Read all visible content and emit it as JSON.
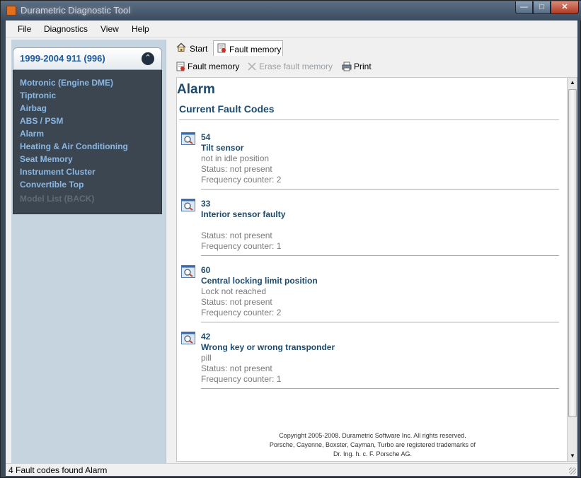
{
  "window": {
    "title": "Durametric Diagnostic Tool"
  },
  "menu": [
    "File",
    "Diagnostics",
    "View",
    "Help"
  ],
  "sidebar": {
    "model": "1999-2004 911 (996)",
    "modules": [
      {
        "label": "Motronic (Engine DME)",
        "enabled": true
      },
      {
        "label": "Tiptronic",
        "enabled": true
      },
      {
        "label": "Airbag",
        "enabled": true
      },
      {
        "label": "ABS / PSM",
        "enabled": true
      },
      {
        "label": "Alarm",
        "enabled": true
      },
      {
        "label": "Heating & Air Conditioning",
        "enabled": true
      },
      {
        "label": "Seat Memory",
        "enabled": true
      },
      {
        "label": "Instrument Cluster",
        "enabled": true
      },
      {
        "label": "Convertible Top",
        "enabled": true
      },
      {
        "label": "Model List (BACK)",
        "enabled": false
      }
    ]
  },
  "tabs": [
    {
      "label": "Start",
      "icon": "home-icon"
    },
    {
      "label": "Fault memory",
      "icon": "fault-memory-icon",
      "active": true
    }
  ],
  "toolbar": {
    "fault_memory": "Fault memory",
    "erase": "Erase fault memory",
    "print": "Print"
  },
  "content": {
    "title": "Alarm",
    "section": "Current Fault Codes",
    "faults": [
      {
        "code": "54",
        "name": "Tilt sensor",
        "detail": "not in idle position",
        "status": "Status: not present",
        "frequency": "Frequency counter: 2"
      },
      {
        "code": "33",
        "name": "Interior sensor faulty",
        "detail": "",
        "status": "Status: not present",
        "frequency": "Frequency counter: 1"
      },
      {
        "code": "60",
        "name": "Central locking limit position",
        "detail": "Lock not reached",
        "status": "Status: not present",
        "frequency": "Frequency counter: 2"
      },
      {
        "code": "42",
        "name": "Wrong key or wrong transponder",
        "detail": "pill",
        "status": "Status: not present",
        "frequency": "Frequency counter: 1"
      }
    ],
    "copyright": [
      "Copyright 2005-2008. Durametric Software Inc. All rights reserved.",
      "Porsche, Cayenne, Boxster, Cayman, Turbo are registered trademarks of",
      "Dr. Ing. h. c. F. Porsche AG."
    ]
  },
  "status": {
    "text": "4 Fault codes found  Alarm"
  },
  "colors": {
    "accent": "#1b4a6e",
    "module_link": "#8ab8e6",
    "rule": "#d4a83a"
  }
}
